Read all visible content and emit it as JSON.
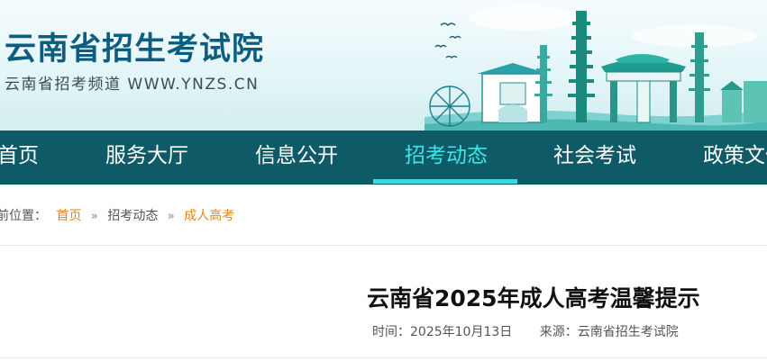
{
  "header": {
    "title": "云南省招生考试院",
    "subtitle": "云南省招考频道 WWW.YNZS.CN"
  },
  "nav": {
    "items": [
      {
        "label": "首页"
      },
      {
        "label": "服务大厅"
      },
      {
        "label": "信息公开"
      },
      {
        "label": "招考动态",
        "active": true
      },
      {
        "label": "社会考试"
      },
      {
        "label": "政策文件"
      }
    ]
  },
  "breadcrumb": {
    "prefix": "前位置：",
    "items": [
      "首页",
      "招考动态",
      "成人高考"
    ]
  },
  "article": {
    "title": "云南省2025年成人高考温馨提示",
    "time_label": "时间：",
    "time_value": "2025年10月13日",
    "source_label": "来源：",
    "source_value": "云南省招生考试院"
  },
  "colors": {
    "nav_bg": "#0e5a66",
    "nav_active": "#3fe4e6",
    "title_blue": "#0c5e80",
    "breadcrumb_link": "#e1861c"
  }
}
